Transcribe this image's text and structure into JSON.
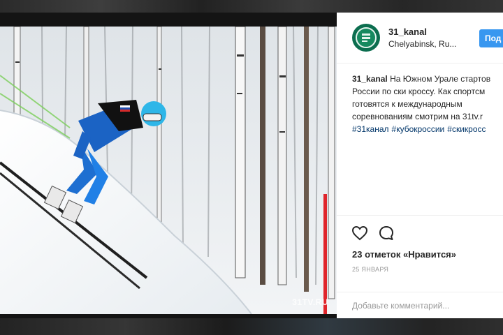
{
  "post": {
    "username": "31_kanal",
    "location": "Chelyabinsk, Ru...",
    "follow_label": "Под",
    "caption": {
      "author": "31_kanal",
      "line1": "На Южном Урале стартов",
      "line2": "России по ски кроссу. Как спортсм",
      "line3": "готовятся к международным",
      "line4": "соревнованиям смотрим на 31tv.r",
      "hashtags": [
        "#31канал",
        "#кубокроссии",
        "#скикросс"
      ]
    },
    "likes": "23 отметок «Нравится»",
    "date": "25 ЯНВАРЯ",
    "comment_placeholder": "Добавьте комментарий...",
    "watermark": "31TV.RU",
    "icons": {
      "like": "heart-icon",
      "comment": "comment-icon",
      "avatar": "channel-logo-icon"
    },
    "colors": {
      "follow_button": "#3897f0",
      "hashtag": "#003569",
      "avatar": "#0c6e4f"
    }
  }
}
